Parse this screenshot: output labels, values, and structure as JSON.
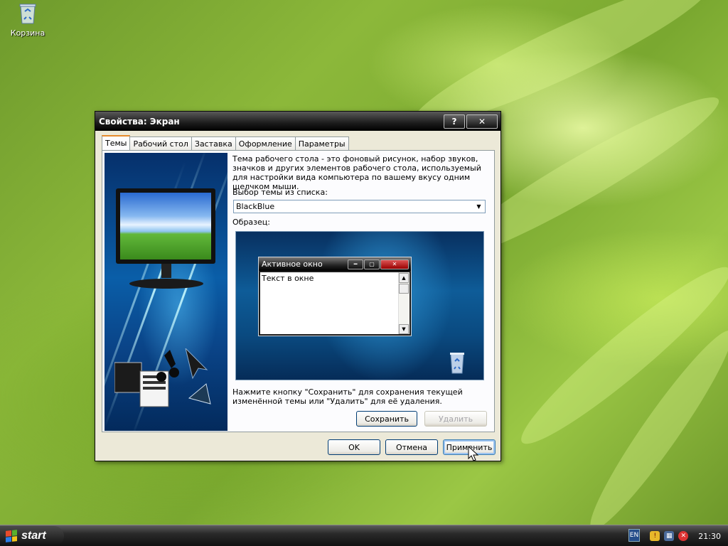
{
  "desktop": {
    "recycle_bin_label": "Корзина"
  },
  "dialog": {
    "title": "Свойства: Экран",
    "help_btn": "?",
    "close_btn": "✕",
    "tabs": [
      {
        "label": "Темы",
        "active": true
      },
      {
        "label": "Рабочий стол"
      },
      {
        "label": "Заставка"
      },
      {
        "label": "Оформление"
      },
      {
        "label": "Параметры"
      }
    ],
    "themes": {
      "description": "Тема рабочего стола - это фоновый рисунок, набор звуков, значков и других элементов рабочего стола, используемый для настройки вида компьютера по вашему вкусу одним щелчком мыши.",
      "select_label": "Выбор темы из списка:",
      "selected_theme": "BlackBlue",
      "preview_label": "Образец:",
      "preview_window": {
        "title": "Активное окно",
        "text": "Текст в окне"
      },
      "save_hint": "Нажмите кнопку \"Сохранить\" для сохранения текущей изменённой темы или \"Удалить\" для её удаления.",
      "save_button": "Сохранить",
      "delete_button": "Удалить"
    },
    "ok_button": "OK",
    "cancel_button": "Отмена",
    "apply_button": "Применить"
  },
  "taskbar": {
    "start_label": "start",
    "language": "EN",
    "clock": "21:30"
  },
  "colors": {
    "accent_tab": "#e68b2c",
    "close_red": "#c83a2a"
  }
}
